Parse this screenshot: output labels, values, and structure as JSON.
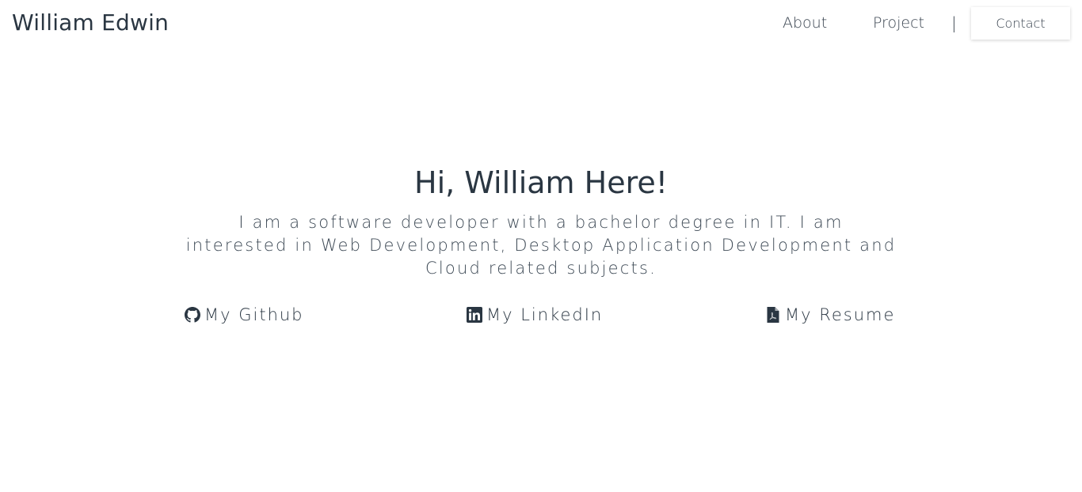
{
  "nav": {
    "brand": "William Edwin",
    "links": [
      {
        "label": "About"
      },
      {
        "label": "Project"
      }
    ],
    "separator": "|",
    "contact_label": "Contact"
  },
  "hero": {
    "title": "Hi, William Here!",
    "description": "I am a software developer with a bachelor degree in IT. I am interested in Web Development, Desktop Application Development and Cloud related subjects."
  },
  "links": [
    {
      "label": "My Github",
      "icon": "github-icon"
    },
    {
      "label": "My LinkedIn",
      "icon": "linkedin-icon"
    },
    {
      "label": "My Resume",
      "icon": "pdf-file-icon"
    }
  ],
  "colors": {
    "text": "#2a3642",
    "background": "#ffffff"
  }
}
